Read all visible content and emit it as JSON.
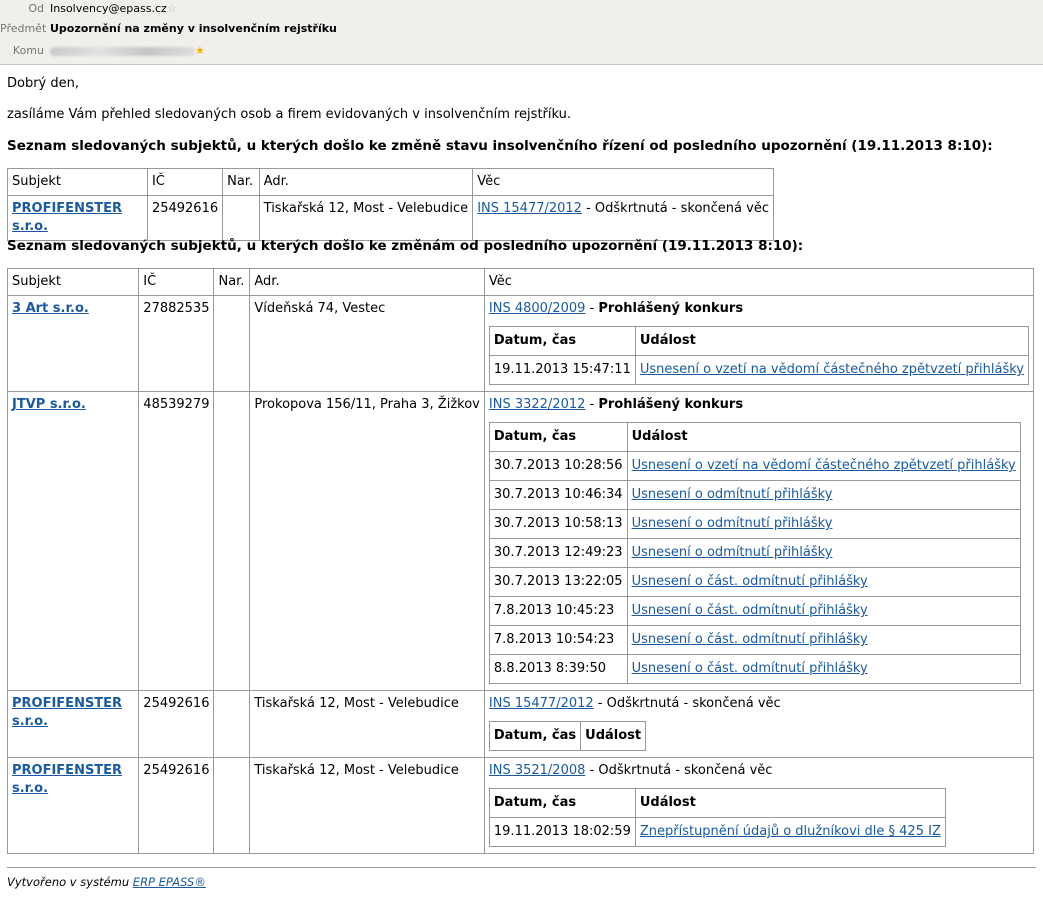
{
  "header": {
    "from_label": "Od",
    "from_value": "Insolvency@epass.cz",
    "subject_label": "Předmět",
    "subject_value": "Upozornění na změny v insolvenčním rejstříku",
    "to_label": "Komu"
  },
  "body": {
    "greeting": "Dobrý den,",
    "intro": "zasíláme Vám přehled sledovaných osob a firem evidovaných v insolvenčním rejstříku.",
    "section1_title": "Seznam sledovaných subjektů, u kterých došlo ke změně stavu insolvenčního řízení od posledního upozornění (19.11.2013 8:10):",
    "section2_title": "Seznam sledovaných subjektů, u kterých došlo ke změnám od posledního upozornění (19.11.2013 8:10):"
  },
  "columns": [
    "Subjekt",
    "IČ",
    "Nar.",
    "Adr.",
    "Věc"
  ],
  "inner_columns": [
    "Datum, čas",
    "Událost"
  ],
  "table1": [
    {
      "subject": "PROFIFENSTER s.r.o.",
      "ic": "25492616",
      "nar": "",
      "addr": "Tiskařská 12, Most - Velebudice",
      "case": "INS 15477/2012",
      "status": " - Odškrtnutá - skončená věc"
    }
  ],
  "table2": [
    {
      "subject": "3 Art s.r.o.",
      "ic": "27882535",
      "nar": "",
      "addr": "Vídeňská 74, Vestec",
      "case": "INS 4800/2009",
      "sep": " - ",
      "status_bold": "Prohlášený konkurs",
      "events": [
        {
          "datetime": "19.11.2013 15:47:11",
          "event": "Usnesení o vzetí na vědomí částečného zpětvzetí přihlášky"
        }
      ]
    },
    {
      "subject": "JTVP s.r.o.",
      "ic": "48539279",
      "nar": "",
      "addr": "Prokopova 156/11, Praha 3, Žižkov",
      "case": "INS 3322/2012",
      "sep": " - ",
      "status_bold": "Prohlášený konkurs",
      "events": [
        {
          "datetime": "30.7.2013 10:28:56",
          "event": "Usnesení o vzetí na vědomí částečného zpětvzetí přihlášky"
        },
        {
          "datetime": "30.7.2013 10:46:34",
          "event": "Usnesení o odmítnutí přihlášky"
        },
        {
          "datetime": "30.7.2013 10:58:13",
          "event": "Usnesení o odmítnutí přihlášky"
        },
        {
          "datetime": "30.7.2013 12:49:23",
          "event": "Usnesení o odmítnutí přihlášky"
        },
        {
          "datetime": "30.7.2013 13:22:05",
          "event": "Usnesení o část. odmítnutí přihlášky"
        },
        {
          "datetime": "7.8.2013 10:45:23",
          "event": "Usnesení o část. odmítnutí přihlášky"
        },
        {
          "datetime": "7.8.2013 10:54:23",
          "event": "Usnesení o část. odmítnutí přihlášky"
        },
        {
          "datetime": "8.8.2013 8:39:50",
          "event": "Usnesení o část. odmítnutí přihlášky"
        }
      ]
    },
    {
      "subject": "PROFIFENSTER s.r.o.",
      "ic": "25492616",
      "nar": "",
      "addr": "Tiskařská 12, Most - Velebudice",
      "case": "INS 15477/2012",
      "status_plain": " - Odškrtnutá - skončená věc",
      "events": []
    },
    {
      "subject": "PROFIFENSTER s.r.o.",
      "ic": "25492616",
      "nar": "",
      "addr": "Tiskařská 12, Most - Velebudice",
      "case": "INS 3521/2008",
      "status_plain": " - Odškrtnutá - skončená věc",
      "events": [
        {
          "datetime": "19.11.2013 18:02:59",
          "event": "Znepřístupnění údajů o dlužníkovi dle § 425 IZ"
        }
      ]
    }
  ],
  "footer": {
    "prefix": "Vytvořeno v systému ",
    "link": "ERP EPASS®"
  },
  "icons": {
    "star_empty": "star-outline-icon",
    "star_filled": "star-filled-icon"
  },
  "colors": {
    "link": "#1a5aa3",
    "header_bg": "#f0efec",
    "star": "#f3b300"
  }
}
